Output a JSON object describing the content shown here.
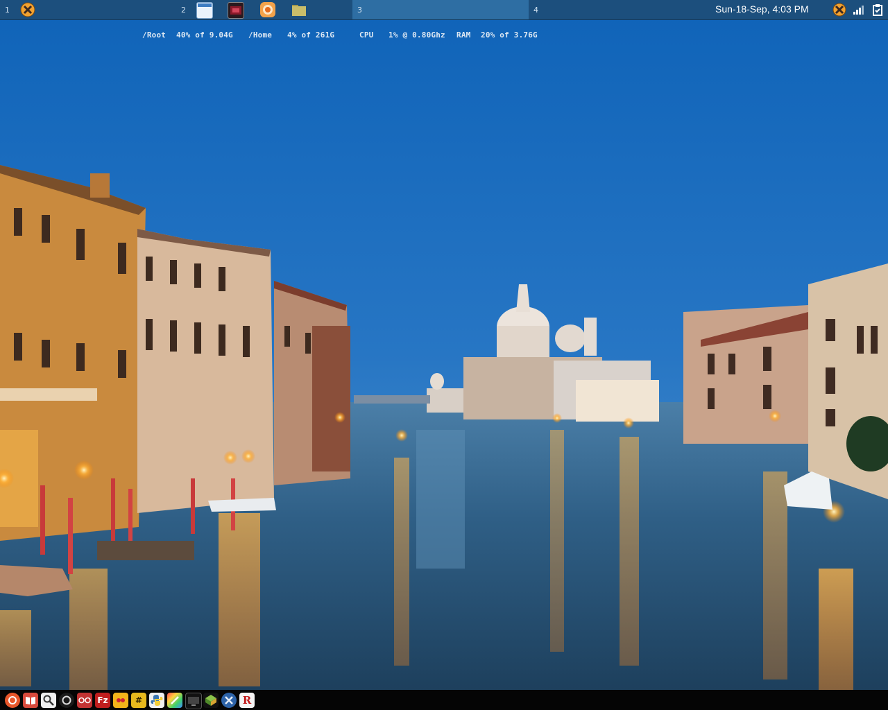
{
  "top_panel": {
    "workspaces": [
      {
        "number": "1",
        "active": false
      },
      {
        "number": "2",
        "active": false
      },
      {
        "number": "3",
        "active": true
      },
      {
        "number": "4",
        "active": false
      }
    ],
    "window_icons": [
      "window-icon",
      "media-app-icon",
      "firefox-icon",
      "folder-icon"
    ],
    "clock": "Sun-18-Sep,  4:03 PM",
    "tray": [
      "xfce-menu-icon",
      "signal-icon",
      "clipboard-icon"
    ],
    "colors": {
      "panel": "#1c4f7d",
      "active_workspace": "#2e6ea3"
    }
  },
  "conky": {
    "root_label": "/Root",
    "root_value": "40% of 9.04G",
    "home_label": "/Home",
    "home_value": "4% of 261G",
    "cpu_label": "CPU",
    "cpu_value": "1% @ 0.80Ghz",
    "ram_label": "RAM",
    "ram_value": "20% of 3.76G"
  },
  "dock": {
    "apps": [
      {
        "name": "ubuntu-software-icon",
        "glyph": ""
      },
      {
        "name": "book-reader-icon",
        "glyph": ""
      },
      {
        "name": "search-icon",
        "glyph": ""
      },
      {
        "name": "refresh-icon",
        "glyph": ""
      },
      {
        "name": "glasses-icon",
        "glyph": ""
      },
      {
        "name": "filezilla-icon",
        "glyph": "Fz"
      },
      {
        "name": "games-icon",
        "glyph": ""
      },
      {
        "name": "hash-icon",
        "glyph": "#"
      },
      {
        "name": "python-icon",
        "glyph": ""
      },
      {
        "name": "paint-icon",
        "glyph": ""
      },
      {
        "name": "monitor-icon",
        "glyph": ""
      },
      {
        "name": "package-icon",
        "glyph": ""
      },
      {
        "name": "xfce-icon",
        "glyph": ""
      },
      {
        "name": "r-app-icon",
        "glyph": "R"
      }
    ]
  }
}
